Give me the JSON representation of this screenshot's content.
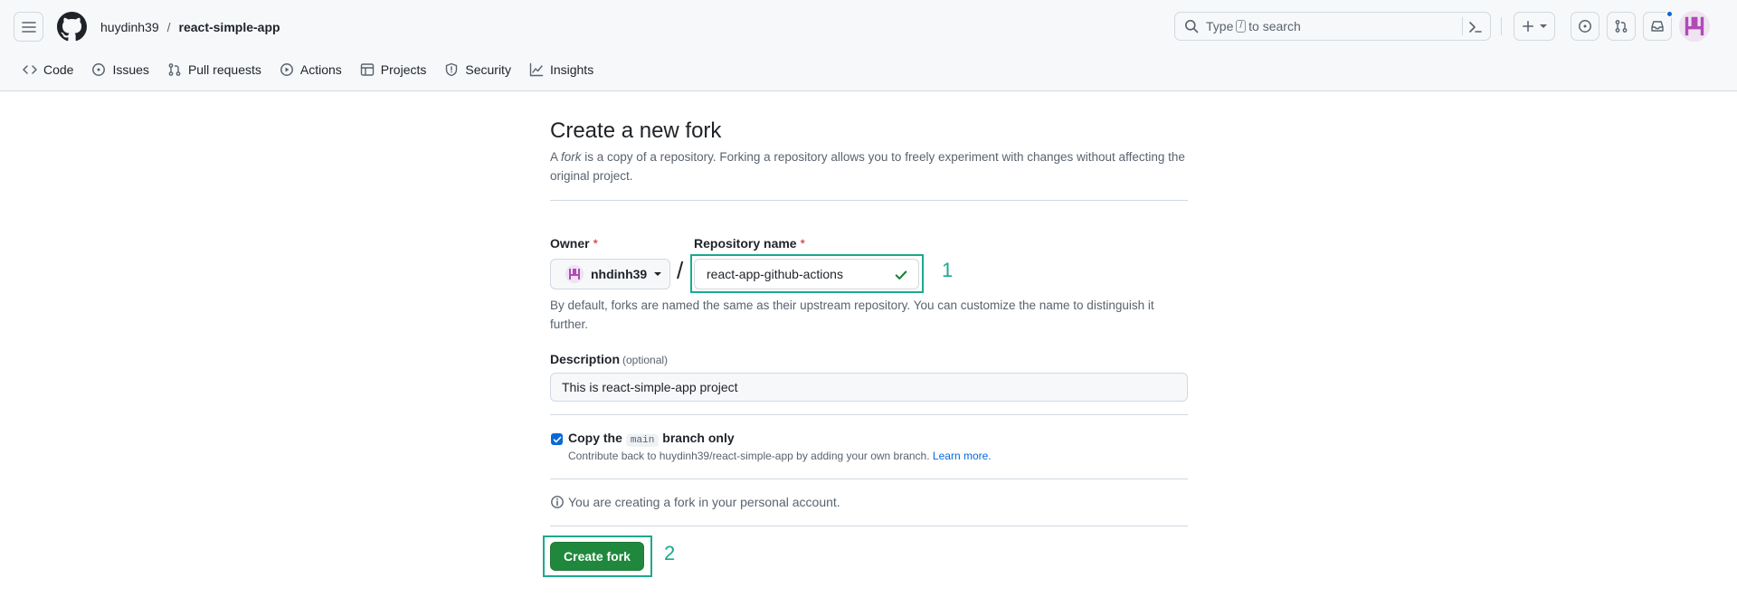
{
  "header": {
    "owner": "huydinh39",
    "separator": "/",
    "repo": "react-simple-app",
    "search": {
      "prefix": "Type",
      "key": "/",
      "suffix": "to search"
    },
    "icons": [
      "hamburger-icon",
      "github-logo-icon",
      "search-icon",
      "command-palette-icon",
      "plus-icon",
      "issues-icon",
      "pull-requests-icon",
      "inbox-icon"
    ]
  },
  "repo_nav": {
    "items": [
      {
        "label": "Code",
        "icon": "code-icon"
      },
      {
        "label": "Issues",
        "icon": "issue-opened-icon"
      },
      {
        "label": "Pull requests",
        "icon": "git-pull-request-icon"
      },
      {
        "label": "Actions",
        "icon": "play-icon"
      },
      {
        "label": "Projects",
        "icon": "table-icon"
      },
      {
        "label": "Security",
        "icon": "shield-icon"
      },
      {
        "label": "Insights",
        "icon": "graph-icon"
      }
    ]
  },
  "form": {
    "title": "Create a new fork",
    "lead_prefix": "A ",
    "lead_em": "fork",
    "lead_suffix": " is a copy of a repository. Forking a repository allows you to freely experiment with changes without affecting the original project.",
    "owner_label": "Owner",
    "required_mark": "*",
    "owner_value": "nhdinh39",
    "slash": "/",
    "repo_name_label": "Repository name",
    "repo_name_value": "react-app-github-actions",
    "name_hint": "By default, forks are named the same as their upstream repository. You can customize the name to distinguish it further.",
    "description_label": "Description",
    "description_optional": "(optional)",
    "description_value": "This is react-simple-app project",
    "copy_checked": true,
    "copy_label_prefix": "Copy the",
    "copy_label_code": "main",
    "copy_label_suffix": "branch only",
    "copy_sub": "Contribute back to huydinh39/react-simple-app by adding your own branch.",
    "learn_more": "Learn more.",
    "info_text": "You are creating a fork in your personal account.",
    "submit_label": "Create fork"
  },
  "annotations": {
    "step1": "1",
    "step2": "2",
    "highlight_color": "#1aaa8c"
  },
  "colors": {
    "primary_button": "#1f883d",
    "link": "#0969da",
    "required": "#d1242f",
    "valid_check": "#1a7f37"
  }
}
